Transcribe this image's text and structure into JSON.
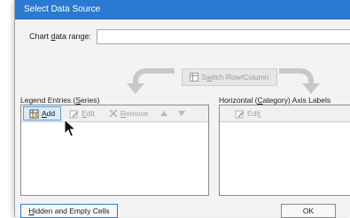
{
  "window": {
    "title": "Select Data Source"
  },
  "range": {
    "label_pre": "Chart ",
    "label_u": "d",
    "label_post": "ata range:",
    "value": ""
  },
  "switch": {
    "pre": "S",
    "u": "w",
    "post": "itch Row/Column"
  },
  "legend": {
    "label_pre": "Legend Entries (",
    "label_u": "S",
    "label_post": "eries)",
    "add": {
      "u": "A",
      "post": "dd"
    },
    "edit": {
      "u": "E",
      "post": "dit"
    },
    "remove": {
      "u": "R",
      "post": "emove"
    }
  },
  "axis": {
    "label_pre": "Horizontal (",
    "label_u": "C",
    "label_post": "ategory) Axis Labels",
    "edit": {
      "pre": "Edi",
      "u": "t"
    }
  },
  "bottom": {
    "hidden_u": "H",
    "hidden_post": "idden and Empty Cells",
    "ok": "OK"
  },
  "colors": {
    "titlebar": "#2b79d0",
    "focus": "#5b9bd5"
  }
}
